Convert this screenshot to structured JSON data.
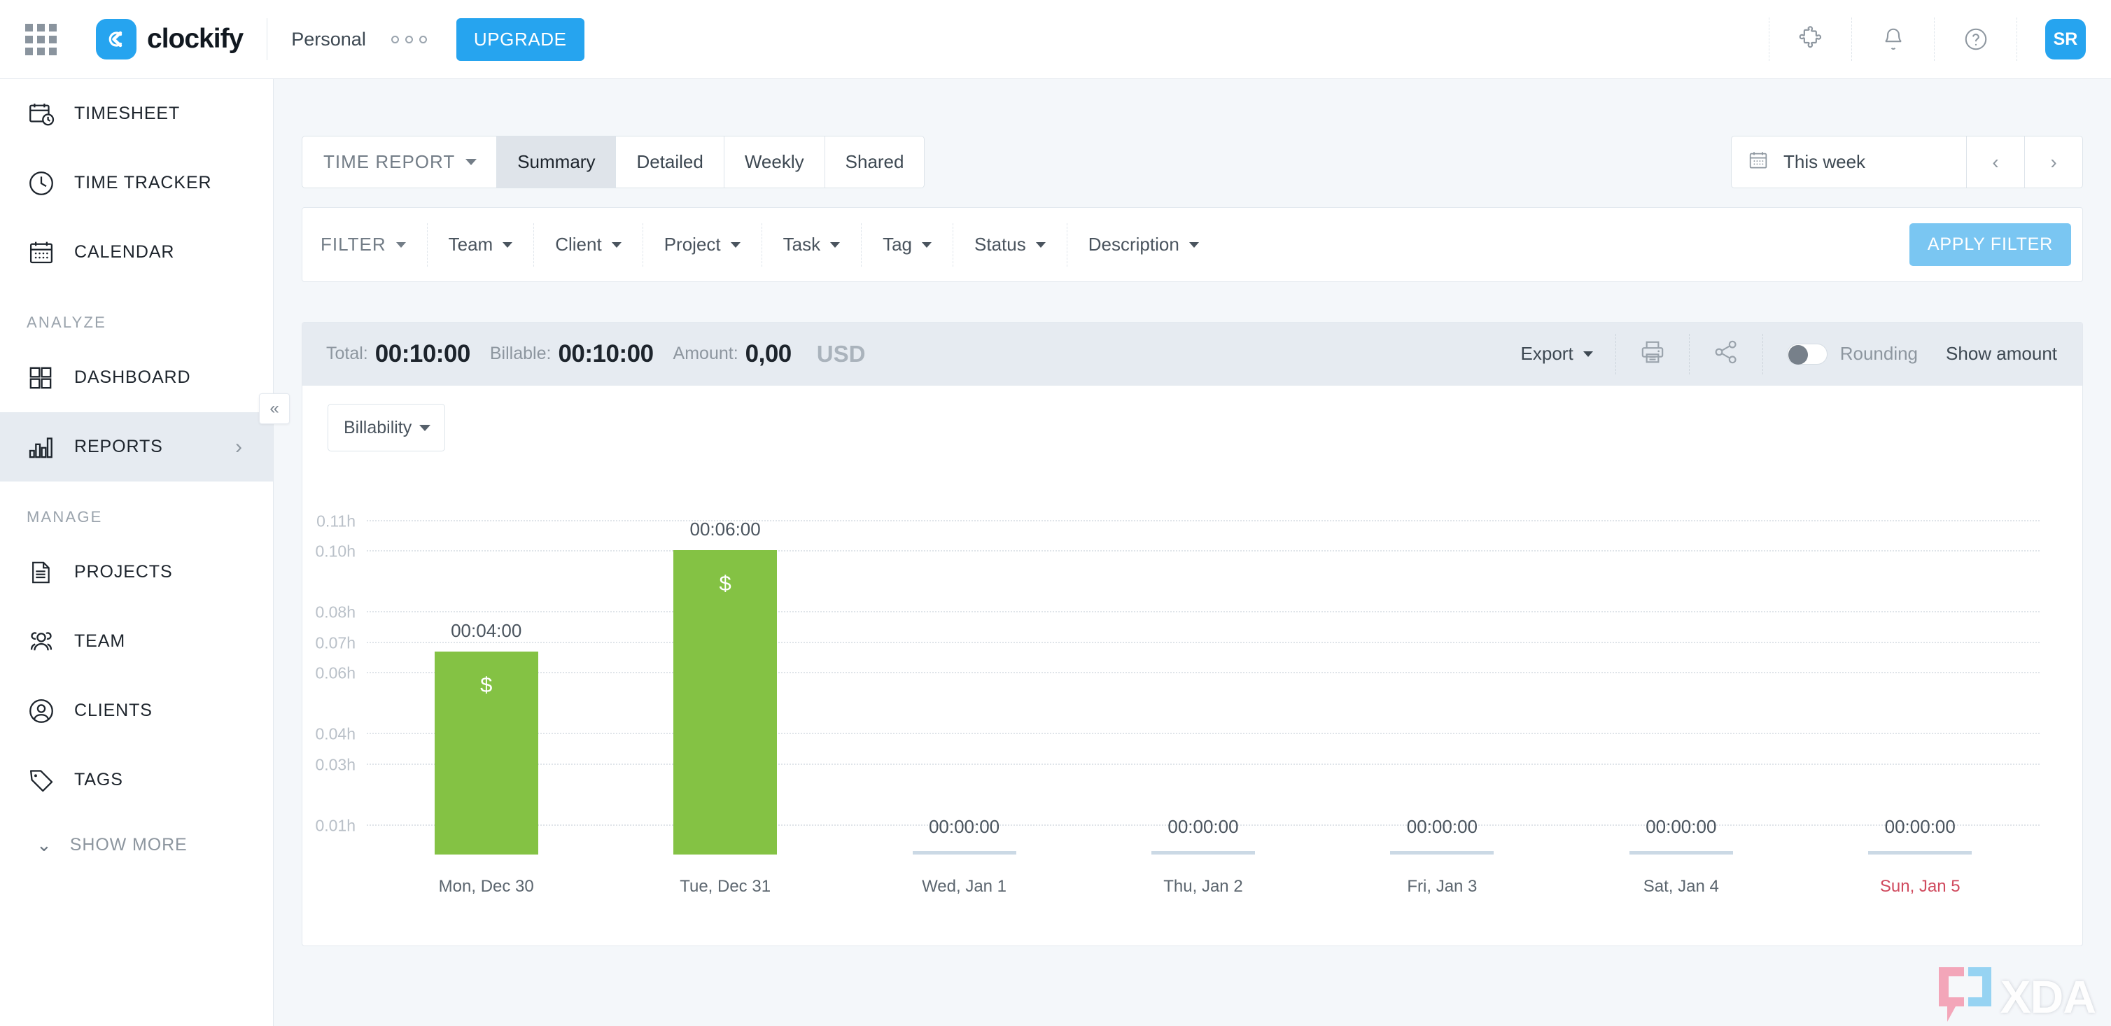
{
  "header": {
    "apps_icon": "grid-apps-icon",
    "logo_icon": "clockify-logo-icon",
    "brand": "clockify",
    "workspace": "Personal",
    "more_icon": "three-dots-icon",
    "upgrade_label": "UPGRADE",
    "icons": [
      {
        "name": "puzzle-icon"
      },
      {
        "name": "bell-icon"
      },
      {
        "name": "help-icon"
      }
    ],
    "avatar_initials": "SR",
    "accent_color": "#26a4ef"
  },
  "sidebar": {
    "items": [
      {
        "label": "TIMESHEET",
        "icon": "timesheet-icon",
        "active": false
      },
      {
        "label": "TIME TRACKER",
        "icon": "clock-icon",
        "active": false
      },
      {
        "label": "CALENDAR",
        "icon": "calendar-icon",
        "active": false
      }
    ],
    "group_analyze": "ANALYZE",
    "analyze_items": [
      {
        "label": "DASHBOARD",
        "icon": "dashboard-icon",
        "active": false
      },
      {
        "label": "REPORTS",
        "icon": "reports-bar-icon",
        "active": true
      }
    ],
    "group_manage": "MANAGE",
    "manage_items": [
      {
        "label": "PROJECTS",
        "icon": "document-icon"
      },
      {
        "label": "TEAM",
        "icon": "people-icon"
      },
      {
        "label": "CLIENTS",
        "icon": "person-circle-icon"
      },
      {
        "label": "TAGS",
        "icon": "tag-icon"
      }
    ],
    "show_more": "SHOW MORE",
    "collapse_icon": "collapse-left-icon",
    "active_bg": "#e6ebf1"
  },
  "tabs": {
    "report_type": "TIME REPORT",
    "items": [
      {
        "label": "Summary",
        "active": true
      },
      {
        "label": "Detailed",
        "active": false
      },
      {
        "label": "Weekly",
        "active": false
      },
      {
        "label": "Shared",
        "active": false
      }
    ]
  },
  "datepicker": {
    "calendar_icon": "calendar-icon",
    "value": "This week",
    "prev_icon": "chevron-left-icon",
    "next_icon": "chevron-right-icon"
  },
  "filters": {
    "label": "FILTER",
    "items": [
      "Team",
      "Client",
      "Project",
      "Task",
      "Tag",
      "Status",
      "Description"
    ],
    "apply_label": "APPLY FILTER",
    "apply_color": "#7ac6f2"
  },
  "summary": {
    "total_label": "Total:",
    "total_value": "00:10:00",
    "billable_label": "Billable:",
    "billable_value": "00:10:00",
    "amount_label": "Amount:",
    "amount_value": "0,00",
    "currency": "USD",
    "export_label": "Export",
    "print_icon": "printer-icon",
    "share_icon": "share-icon",
    "rounding_label": "Rounding",
    "rounding_on": false,
    "show_amount_label": "Show amount"
  },
  "chart_controls": {
    "grouping": "Billability"
  },
  "chart_data": {
    "type": "bar",
    "title": "",
    "xlabel": "",
    "ylabel": "",
    "categories": [
      "Mon, Dec 30",
      "Tue, Dec 31",
      "Wed, Jan 1",
      "Thu, Jan 2",
      "Fri, Jan 3",
      "Sat, Jan 4",
      "Sun, Jan 5"
    ],
    "values": [
      0.0667,
      0.1,
      0,
      0,
      0,
      0,
      0
    ],
    "value_labels": [
      "00:04:00",
      "00:06:00",
      "00:00:00",
      "00:00:00",
      "00:00:00",
      "00:00:00",
      "00:00:00"
    ],
    "bar_markers": [
      "$",
      "$",
      "",
      "",
      "",
      "",
      ""
    ],
    "weekend_flags": [
      false,
      false,
      false,
      false,
      false,
      false,
      true
    ],
    "ytick_labels": [
      "0.11h",
      "0.10h",
      "0.08h",
      "0.07h",
      "0.06h",
      "0.04h",
      "0.03h",
      "0.01h"
    ],
    "ytick_values": [
      0.11,
      0.1,
      0.08,
      0.07,
      0.06,
      0.04,
      0.03,
      0.01
    ],
    "ylim": [
      0,
      0.115
    ],
    "grid": true,
    "bar_color": "#84c244",
    "zero_bar_color": "#cbd9e5",
    "legend": "none"
  },
  "watermark": {
    "text": "XDA"
  }
}
